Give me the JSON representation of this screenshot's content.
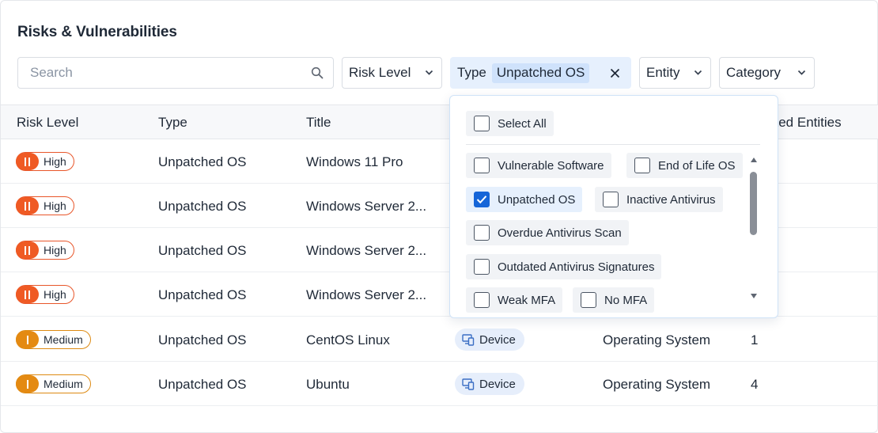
{
  "page": {
    "title": "Risks & Vulnerabilities"
  },
  "search": {
    "placeholder": "Search",
    "value": ""
  },
  "filters": {
    "risk_level": "Risk Level",
    "type": {
      "label": "Type",
      "selected": "Unpatched OS"
    },
    "entity": "Entity",
    "category": "Category"
  },
  "columns": [
    "Risk Level",
    "Type",
    "Title",
    "",
    "",
    "cted Entities"
  ],
  "rows": [
    {
      "risk": "High",
      "type": "Unpatched OS",
      "title": "Windows 11 Pro",
      "entity": "",
      "category": "",
      "affected": ""
    },
    {
      "risk": "High",
      "type": "Unpatched OS",
      "title": "Windows Server 2...",
      "entity": "",
      "category": "",
      "affected": ""
    },
    {
      "risk": "High",
      "type": "Unpatched OS",
      "title": "Windows Server 2...",
      "entity": "",
      "category": "",
      "affected": ""
    },
    {
      "risk": "High",
      "type": "Unpatched OS",
      "title": "Windows Server 2...",
      "entity": "",
      "category": "",
      "affected": ""
    },
    {
      "risk": "Medium",
      "type": "Unpatched OS",
      "title": "CentOS Linux",
      "entity": "Device",
      "category": "Operating System",
      "affected": "1"
    },
    {
      "risk": "Medium",
      "type": "Unpatched OS",
      "title": "Ubuntu",
      "entity": "Device",
      "category": "Operating System",
      "affected": "4"
    }
  ],
  "dropdown": {
    "select_all": "Select All",
    "options": [
      {
        "label": "Vulnerable Software",
        "checked": false
      },
      {
        "label": "End of Life OS",
        "checked": false
      },
      {
        "label": "Unpatched OS",
        "checked": true
      },
      {
        "label": "Inactive Antivirus",
        "checked": false
      },
      {
        "label": "Overdue Antivirus Scan",
        "checked": false
      },
      {
        "label": "Outdated Antivirus Signatures",
        "checked": false
      },
      {
        "label": "Weak MFA",
        "checked": false
      },
      {
        "label": "No MFA",
        "checked": false
      }
    ]
  },
  "colors": {
    "high": "#ef5a24",
    "medium": "#e48a12",
    "accent": "#1565d8",
    "filter_active_bg": "#e6f0fd",
    "chip_bg": "#cfe2fb",
    "entity_tag_bg": "#e6eefb"
  },
  "icons": {
    "search": "search-icon",
    "chevron": "chevron-down-icon",
    "clear": "close-icon",
    "entity": "device-icon",
    "check": "check-icon"
  }
}
